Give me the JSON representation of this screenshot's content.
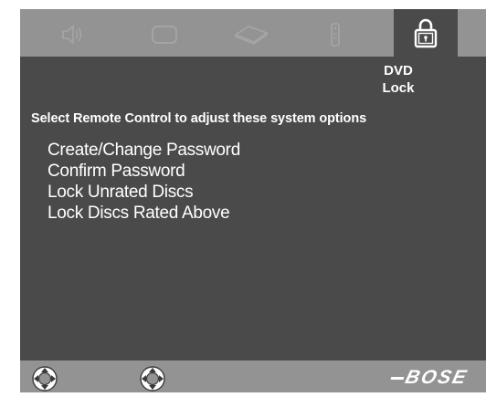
{
  "tabs": [
    {
      "icon": "speaker-icon",
      "active": false
    },
    {
      "icon": "screen-icon",
      "active": false
    },
    {
      "icon": "disc-icon",
      "active": false
    },
    {
      "icon": "remote-icon",
      "active": false
    },
    {
      "icon": "lock-icon",
      "active": true
    }
  ],
  "active_tab": {
    "line1": "DVD",
    "line2": "Lock"
  },
  "instruction": "Select Remote Control to adjust these system options",
  "options": [
    "Create/Change Password",
    "Confirm Password",
    "Lock Unrated Discs",
    "Lock Discs Rated Above"
  ],
  "footer": {
    "nav_icons": [
      "navigation-pad-icon",
      "navigation-pad-icon"
    ],
    "logo": "BOSE"
  },
  "colors": {
    "frame": "#939393",
    "panel": "#4a4a4a",
    "text": "#ffffff",
    "inactive_icon": "#a6a6a6"
  }
}
